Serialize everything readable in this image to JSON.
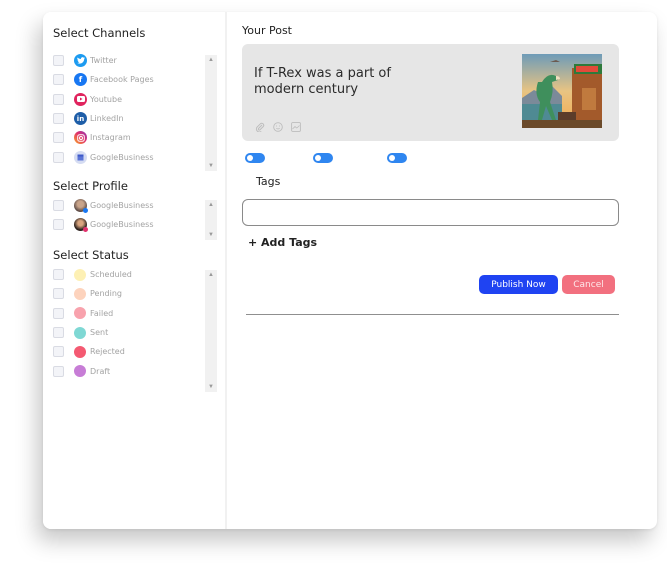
{
  "sidebar": {
    "channels": {
      "title": "Select Channels",
      "items": [
        {
          "label": "Twitter",
          "icon": "twitter-icon",
          "color": "#1d9bf0"
        },
        {
          "label": "Facebook Pages",
          "icon": "facebook-icon",
          "color": "#1877f2"
        },
        {
          "label": "Youtube",
          "icon": "youtube-icon",
          "color": "#e0245e"
        },
        {
          "label": "LinkedIn",
          "icon": "linkedin-icon",
          "color": "#1e5ea8"
        },
        {
          "label": "Instagram",
          "icon": "instagram-icon",
          "color": "#d6249f"
        },
        {
          "label": "GoogleBusiness",
          "icon": "google-business-icon",
          "color": "#c9d3f0"
        }
      ]
    },
    "profile": {
      "title": "Select Profile",
      "items": [
        {
          "label": "GoogleBusiness",
          "icon": "profile-avatar"
        },
        {
          "label": "GoogleBusiness",
          "icon": "profile-avatar"
        }
      ]
    },
    "status": {
      "title": "Select Status",
      "items": [
        {
          "label": "Scheduled",
          "color": "#fdf0b4"
        },
        {
          "label": "Pending",
          "color": "#fdd3bd"
        },
        {
          "label": "Failed",
          "color": "#f8a2ad"
        },
        {
          "label": "Sent",
          "color": "#7fd8d4"
        },
        {
          "label": "Rejected",
          "color": "#f45a72"
        },
        {
          "label": "Draft",
          "color": "#c77dd6"
        }
      ]
    }
  },
  "main": {
    "title": "Your Post",
    "post_text": "If T-Rex was a part of modern century",
    "post_tools": [
      "attachment-icon",
      "emoji-icon",
      "image-icon"
    ],
    "post_image_alt": "T-Rex at a modern shop illustration",
    "toggles": [
      true,
      true,
      true
    ],
    "tags_label": "Tags",
    "tags_value": "",
    "add_tags_label": "+ Add Tags",
    "publish_label": "Publish Now",
    "cancel_label": "Cancel"
  },
  "colors": {
    "publish": "#1f43f2",
    "cancel": "#f2707f",
    "toggle": "#2f86f0"
  }
}
